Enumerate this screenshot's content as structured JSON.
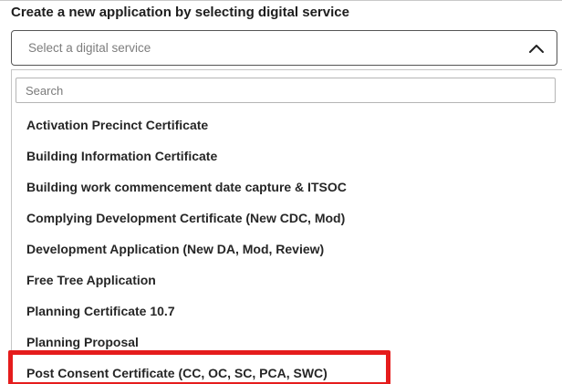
{
  "form": {
    "heading": "Create a new application by selecting digital service",
    "select_placeholder": "Select a digital service",
    "chevron_icon": "chevron-up-icon"
  },
  "dropdown": {
    "search_placeholder": "Search",
    "options": [
      "Activation Precinct Certificate",
      "Building Information Certificate",
      "Building work commencement date capture & ITSOC",
      "Complying Development Certificate (New CDC, Mod)",
      "Development Application (New DA, Mod, Review)",
      "Free Tree Application",
      "Planning Certificate 10.7",
      "Planning Proposal",
      "Post Consent Certificate (CC, OC, SC, PCA, SWC)"
    ],
    "highlighted_option_index": 8
  },
  "colors": {
    "highlight": "#e51c1c",
    "select_border": "#555555",
    "option_text": "#262626"
  }
}
